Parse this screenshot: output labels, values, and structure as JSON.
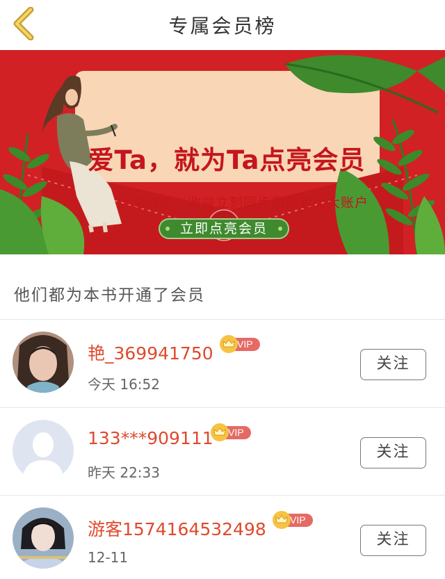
{
  "header": {
    "title": "专属会员榜"
  },
  "banner": {
    "title": "爱Ta，就为Ta点亮会员",
    "subtitle": "点亮成功，收益立刻同步到作者大大账户",
    "button_label": "立即点亮会员",
    "colors": {
      "background": "#d12124",
      "card": "#f9d6b6",
      "button": "#3f8a2e"
    }
  },
  "section": {
    "title": "他们都为本书开通了会员"
  },
  "members": [
    {
      "name": "艳_369941750",
      "vip_label": "VIP",
      "time": "今天 16:52",
      "follow_label": "关注"
    },
    {
      "name": "133***909111",
      "vip_label": "VIP",
      "time": "昨天 22:33",
      "follow_label": "关注"
    },
    {
      "name": "游客1574164532498",
      "vip_label": "VIP",
      "time": "12-11",
      "follow_label": "关注"
    }
  ]
}
